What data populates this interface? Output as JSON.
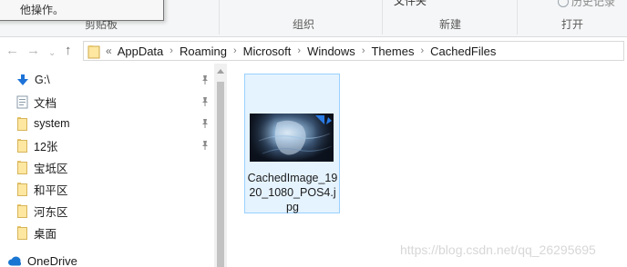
{
  "ribbon": {
    "clipboard_group": "剪贴板",
    "organize_group": "组织",
    "new_group": "新建",
    "open_group": "打开",
    "partial_label_folder": "文件夹",
    "history_label": "历史记录"
  },
  "tooltip": {
    "text": "他操作。"
  },
  "address_bar": {
    "overflow_chevron": "«",
    "crumbs": [
      "AppData",
      "Roaming",
      "Microsoft",
      "Windows",
      "Themes",
      "CachedFiles"
    ],
    "separator": "›"
  },
  "sidebar": {
    "items": [
      {
        "label": "G:\\",
        "icon": "download-arrow-icon",
        "pinned": true
      },
      {
        "label": "文档",
        "icon": "document-icon",
        "pinned": true
      },
      {
        "label": "system",
        "icon": "folder-icon",
        "pinned": true
      },
      {
        "label": "12张",
        "icon": "folder-icon",
        "pinned": true
      },
      {
        "label": "宝坻区",
        "icon": "folder-icon",
        "pinned": false
      },
      {
        "label": "和平区",
        "icon": "folder-icon",
        "pinned": false
      },
      {
        "label": "河东区",
        "icon": "folder-icon",
        "pinned": false
      },
      {
        "label": "桌面",
        "icon": "folder-icon",
        "pinned": false
      },
      {
        "label": "OneDrive",
        "icon": "cloud-icon",
        "pinned": false
      }
    ]
  },
  "files": [
    {
      "name": "CachedImage_1920_1080_POS4.jpg",
      "selected": true
    }
  ],
  "watermark": "https://blog.csdn.net/qq_26295695",
  "colors": {
    "selection_bg": "#e5f3ff",
    "selection_border": "#99d1ff",
    "ribbon_bg": "#f5f6f7"
  }
}
